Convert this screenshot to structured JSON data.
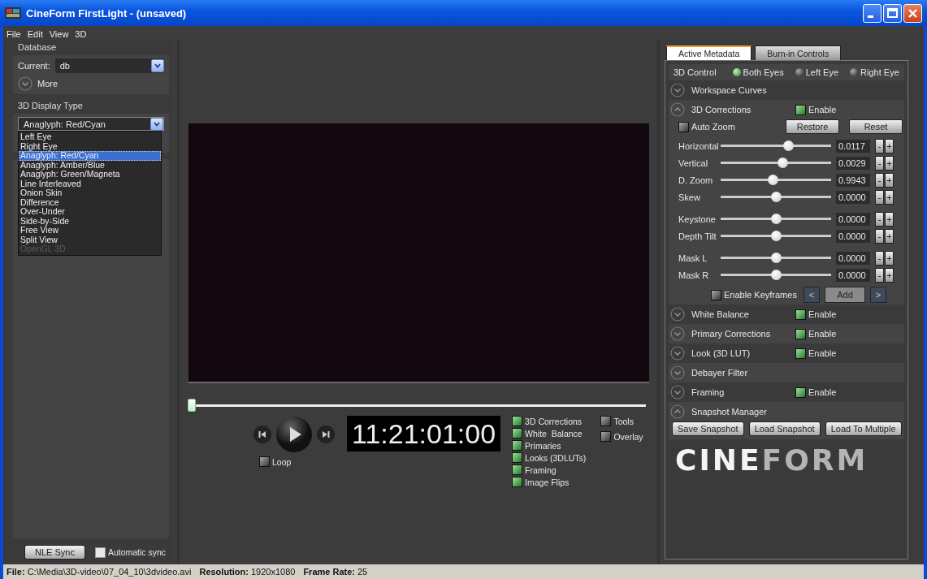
{
  "window": {
    "title": "CineForm FirstLight - (unsaved)"
  },
  "menu": [
    "File",
    "Edit",
    "View",
    "3D"
  ],
  "database": {
    "heading": "Database",
    "current_label": "Current:",
    "current_value": "db",
    "more": {
      "label": "More",
      "expanded": false
    }
  },
  "display_type": {
    "heading": "3D Display Type",
    "value": "Anaglyph: Red/Cyan",
    "options": [
      {
        "label": "Left Eye",
        "selected": false,
        "disabled": false
      },
      {
        "label": "Right Eye",
        "selected": false,
        "disabled": false
      },
      {
        "label": "Anaglyph: Red/Cyan",
        "selected": true,
        "disabled": false
      },
      {
        "label": "Anaglyph: Amber/Blue",
        "selected": false,
        "disabled": false
      },
      {
        "label": "Anaglyph: Green/Magneta",
        "selected": false,
        "disabled": false
      },
      {
        "label": "Line Interleaved",
        "selected": false,
        "disabled": false
      },
      {
        "label": "Onion Skin",
        "selected": false,
        "disabled": false
      },
      {
        "label": "Difference",
        "selected": false,
        "disabled": false
      },
      {
        "label": "Over-Under",
        "selected": false,
        "disabled": false
      },
      {
        "label": "Side-by-Side",
        "selected": false,
        "disabled": false
      },
      {
        "label": "Free View",
        "selected": false,
        "disabled": false
      },
      {
        "label": "Split View",
        "selected": false,
        "disabled": false
      },
      {
        "label": "OpenGL 3D",
        "selected": false,
        "disabled": true
      }
    ]
  },
  "sync": {
    "button": "NLE Sync",
    "automatic": {
      "label": "Automatic sync",
      "checked": false
    }
  },
  "player": {
    "timeline": {
      "level": 0
    },
    "timecode": "11:21:01:00",
    "loop": {
      "label": "Loop",
      "checked": false
    },
    "overlays": [
      {
        "label": "3D Corrections",
        "checked": true
      },
      {
        "label": "White  Balance",
        "checked": true
      },
      {
        "label": "Primaries",
        "checked": true
      },
      {
        "label": "Looks (3DLUTs)",
        "checked": true
      },
      {
        "label": "Framing",
        "checked": true
      },
      {
        "label": "Image Flips",
        "checked": true
      }
    ],
    "extras": [
      {
        "label": "Tools",
        "checked": false
      },
      {
        "label": "Overlay",
        "checked": false
      }
    ]
  },
  "inspector": {
    "tabs": [
      {
        "label": "Active Metadata",
        "selected": true
      },
      {
        "label": "Burn-in Controls",
        "selected": false
      }
    ],
    "control_3d": {
      "label": "3D Control",
      "options": [
        {
          "label": "Both Eyes",
          "selected": true
        },
        {
          "label": "Left Eye",
          "selected": false
        },
        {
          "label": "Right Eye",
          "selected": false
        }
      ]
    },
    "sections": [
      {
        "kind": "plain",
        "title": "Workspace Curves",
        "expanded": false
      },
      {
        "kind": "corrections",
        "title": "3D Corrections",
        "expanded": true,
        "enable": {
          "label": "Enable",
          "checked": true
        },
        "auto_zoom": {
          "label": "Auto Zoom",
          "checked": false
        },
        "restore": "Restore",
        "reset": "Reset",
        "slider_groups": [
          [
            {
              "label": "Horizontal",
              "level": 0.61,
              "value": "0.0117",
              "decrement": "-",
              "increment": "+"
            },
            {
              "label": "Vertical",
              "level": 0.56,
              "value": "0.0029",
              "decrement": "-",
              "increment": "+"
            },
            {
              "label": "D. Zoom",
              "level": 0.47,
              "value": "0.9943",
              "decrement": "-",
              "increment": "+"
            },
            {
              "label": "Skew",
              "level": 0.5,
              "value": "0.0000",
              "decrement": "-",
              "increment": "+"
            }
          ],
          [
            {
              "label": "Keystone",
              "level": 0.5,
              "value": "0.0000",
              "decrement": "-",
              "increment": "+"
            },
            {
              "label": "Depth Tilt",
              "level": 0.5,
              "value": "0.0000",
              "decrement": "-",
              "increment": "+"
            }
          ],
          [
            {
              "label": "Mask L",
              "level": 0.5,
              "value": "0.0000",
              "decrement": "-",
              "increment": "+"
            },
            {
              "label": "Mask R",
              "level": 0.5,
              "value": "0.0000",
              "decrement": "-",
              "increment": "+"
            }
          ]
        ],
        "keyframes": {
          "label": "Enable Keyframes",
          "checked": false,
          "prev": "<",
          "add": "Add",
          "next": ">"
        }
      },
      {
        "kind": "plain",
        "title": "White Balance",
        "expanded": false,
        "enable": {
          "label": "Enable",
          "checked": true
        }
      },
      {
        "kind": "plain",
        "title": "Primary Corrections",
        "expanded": false,
        "enable": {
          "label": "Enable",
          "checked": true
        }
      },
      {
        "kind": "plain",
        "title": "Look (3D LUT)",
        "expanded": false,
        "enable": {
          "label": "Enable",
          "checked": true
        }
      },
      {
        "kind": "plain",
        "title": "Debayer Filter",
        "expanded": false
      },
      {
        "kind": "plain",
        "title": "Framing",
        "expanded": false,
        "enable": {
          "label": "Enable",
          "checked": true
        }
      },
      {
        "kind": "snapshot",
        "title": "Snapshot Manager",
        "expanded": true,
        "buttons": [
          "Save Snapshot",
          "Load Snapshot",
          "Load To Multiple"
        ]
      }
    ],
    "logo": {
      "left": "CINE",
      "right": "FORM"
    }
  },
  "status_bar": [
    {
      "label": "File:",
      "value": "C:\\Media\\3D-video\\07_04_10\\3dvideo.avi"
    },
    {
      "label": "Resolution:",
      "value": "1920x1080"
    },
    {
      "label": "Frame Rate:",
      "value": "25"
    }
  ]
}
